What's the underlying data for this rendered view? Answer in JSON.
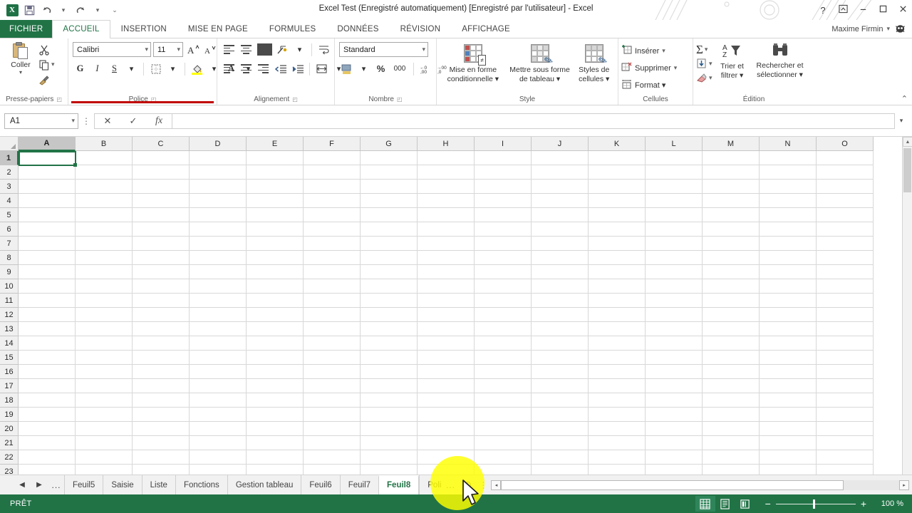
{
  "titlebar": {
    "app_icon": "excel-logo",
    "quick_access": [
      {
        "name": "save",
        "glyph": "⬜"
      },
      {
        "name": "undo",
        "glyph": "↶"
      },
      {
        "name": "redo",
        "glyph": "↷"
      },
      {
        "name": "customize",
        "glyph": "≡"
      }
    ],
    "title": "Excel Test (Enregistré automatiquement) [Enregistré par l'utilisateur] - Excel",
    "help": "?",
    "ribbon_display": "⬚",
    "minimize": "–",
    "maximize": "❐",
    "close": "✕"
  },
  "tabs": {
    "file": "FICHIER",
    "items": [
      {
        "label": "ACCUEIL",
        "active": true
      },
      {
        "label": "INSERTION",
        "active": false
      },
      {
        "label": "MISE EN PAGE",
        "active": false
      },
      {
        "label": "FORMULES",
        "active": false
      },
      {
        "label": "DONNÉES",
        "active": false
      },
      {
        "label": "RÉVISION",
        "active": false
      },
      {
        "label": "AFFICHAGE",
        "active": false
      }
    ],
    "user": "Maxime Firmin",
    "user_chevron": "▾"
  },
  "ribbon": {
    "clipboard": {
      "label": "Presse-papiers",
      "paste": "Coller",
      "paste_chevron": "▾",
      "cut": "✂",
      "copy": "⧉",
      "format_painter": "✒",
      "dialog": "⤵"
    },
    "font": {
      "label": "Police",
      "font_name": "Calibri",
      "font_size": "11",
      "grow": "A",
      "shrink": "A",
      "bold": "G",
      "italic": "I",
      "underline": "S",
      "borders": "⬚",
      "fill_color": "◑",
      "font_color": "A",
      "chevron": "▾",
      "dialog": "⤵"
    },
    "alignment": {
      "label": "Alignement",
      "wrap_text": "☰",
      "merge": "⊞",
      "orientation": "⟲",
      "indent_dec": "←",
      "indent_inc": "→",
      "dialog": "⤵"
    },
    "number": {
      "label": "Nombre",
      "format": "Standard",
      "accounting": "¤",
      "percent": "%",
      "thousands": "000",
      "dec_inc": "←,0",
      "dec_dec": "→,0",
      "dialog": "⤵"
    },
    "style": {
      "label": "Style",
      "conditional_l1": "Mise en forme",
      "conditional_l2": "conditionnelle ▾",
      "table_l1": "Mettre sous forme",
      "table_l2": "de tableau ▾",
      "cellstyles_l1": "Styles de",
      "cellstyles_l2": "cellules ▾"
    },
    "cells": {
      "label": "Cellules",
      "insert": "Insérer",
      "delete": "Supprimer",
      "format": "Format ▾",
      "chevron": "▾"
    },
    "edition": {
      "label": "Édition",
      "autosum": "Σ",
      "fill": "⬇",
      "clear": "◢",
      "sort_l1": "Trier et",
      "sort_l2": "filtrer ▾",
      "find_l1": "Rechercher et",
      "find_l2": "sélectionner ▾",
      "chevron": "▾"
    },
    "collapse": "⌃"
  },
  "formula_bar": {
    "name_box": "A1",
    "name_chevron": "▾",
    "dots": "⋮",
    "cancel": "✕",
    "confirm": "✓",
    "fx": "fx",
    "value": "",
    "expand": "▾"
  },
  "grid": {
    "columns": [
      "A",
      "B",
      "C",
      "D",
      "E",
      "F",
      "G",
      "H",
      "I",
      "J",
      "K",
      "L",
      "M",
      "N",
      "O"
    ],
    "rows": [
      1,
      2,
      3,
      4,
      5,
      6,
      7,
      8,
      9,
      10,
      11,
      12,
      13,
      14,
      15,
      16,
      17,
      18,
      19,
      20,
      21,
      22,
      23
    ],
    "selected_cell": "A1",
    "selected_column": "A",
    "selected_row": 1,
    "scroll_up": "▲",
    "scroll_down": "▼"
  },
  "sheet_tabs": {
    "first": "◀",
    "prev": "◀",
    "next": "▶",
    "dots_left": "...",
    "items": [
      {
        "label": "Feuil5",
        "active": false
      },
      {
        "label": "Saisie",
        "active": false
      },
      {
        "label": "Liste",
        "active": false
      },
      {
        "label": "Fonctions",
        "active": false
      },
      {
        "label": "Gestion tableau",
        "active": false
      },
      {
        "label": "Feuil6",
        "active": false
      },
      {
        "label": "Feuil7",
        "active": false
      },
      {
        "label": "Feuil8",
        "active": true
      },
      {
        "label": "Poli",
        "active": false,
        "truncated": true
      }
    ],
    "dots_right": "...",
    "add_sheet": "⊕",
    "tab_menu": "⋮",
    "hs_left": "◂",
    "hs_right": "▸"
  },
  "status_bar": {
    "state": "PRÊT",
    "view_normal": "☰",
    "view_layout": "▤",
    "view_break": "▥",
    "zoom_out": "−",
    "zoom_in": "+",
    "zoom_value": "100 %"
  },
  "colors": {
    "excel_green": "#217346",
    "file_tab_green": "#217346",
    "status_green": "#217346",
    "selection_green": "#217346",
    "header_gray": "#f0f0f0",
    "click_highlight": "#ffff00"
  }
}
